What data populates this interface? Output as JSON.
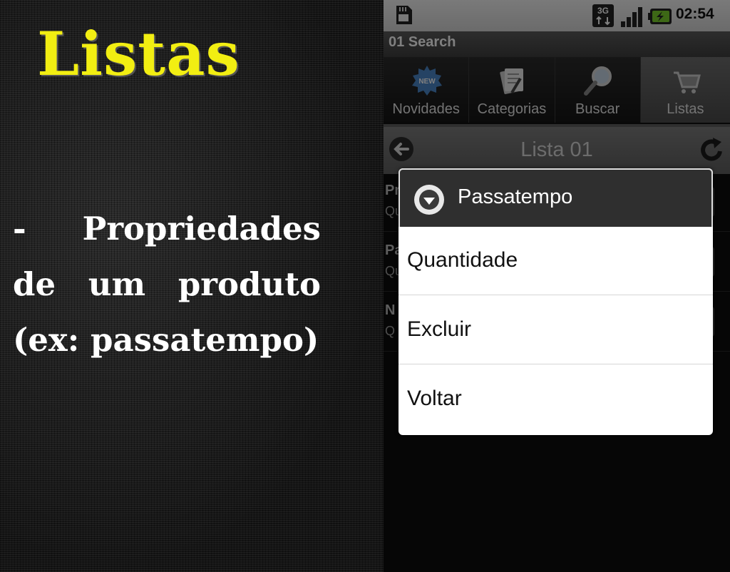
{
  "slide": {
    "title": "Listas",
    "body": "- Propriedades de um produto (ex: passatempo)",
    "title_color": "#f2ee12",
    "body_color": "#ffffff"
  },
  "status_bar": {
    "time": "02:54",
    "network_label": "3G",
    "icons": [
      "sd-card-icon",
      "3g-icon",
      "signal-icon",
      "battery-charging-icon"
    ]
  },
  "app_bar": {
    "title": "01 Search"
  },
  "tabs": [
    {
      "label": "Novidades",
      "icon": "new-badge-icon",
      "active": false
    },
    {
      "label": "Categorias",
      "icon": "categories-icon",
      "active": false
    },
    {
      "label": "Buscar",
      "icon": "magnifier-icon",
      "active": false
    },
    {
      "label": "Listas",
      "icon": "cart-icon",
      "active": true
    }
  ],
  "list_header": {
    "title": "Lista 01",
    "back_icon": "back-arrow-icon",
    "refresh_icon": "refresh-icon"
  },
  "background_list": [
    {
      "name": "Pr",
      "sub": "Qu"
    },
    {
      "name": "Pa",
      "sub": "Qu"
    },
    {
      "name": "N",
      "sub": "Q"
    }
  ],
  "dialog": {
    "title": "Passatempo",
    "icon": "dropdown-circle-icon",
    "items": [
      {
        "label": "Quantidade"
      },
      {
        "label": "Excluir"
      },
      {
        "label": "Voltar"
      }
    ]
  }
}
